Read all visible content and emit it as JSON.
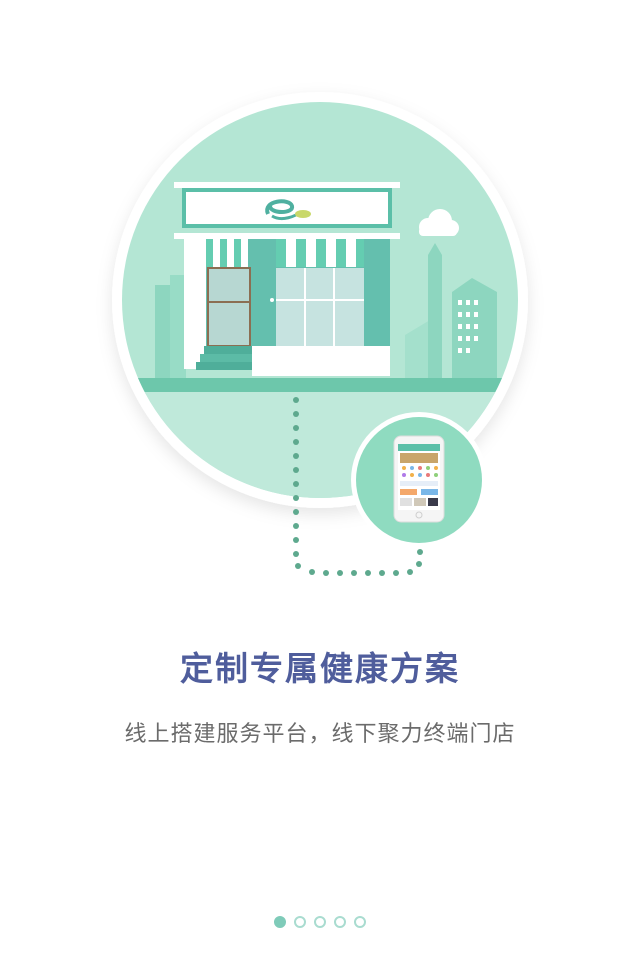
{
  "onboarding": {
    "title": "定制专属健康方案",
    "subtitle": "线上搭建服务平台，线下聚力终端门店",
    "page_indicator": {
      "total": 5,
      "current": 1
    }
  },
  "colors": {
    "title": "#4f5d9c",
    "subtitle": "#6b6b6b",
    "circle_fill": "#b4e6d4",
    "accent_green": "#5bbfa8",
    "dot_active": "#7fcbb9"
  }
}
